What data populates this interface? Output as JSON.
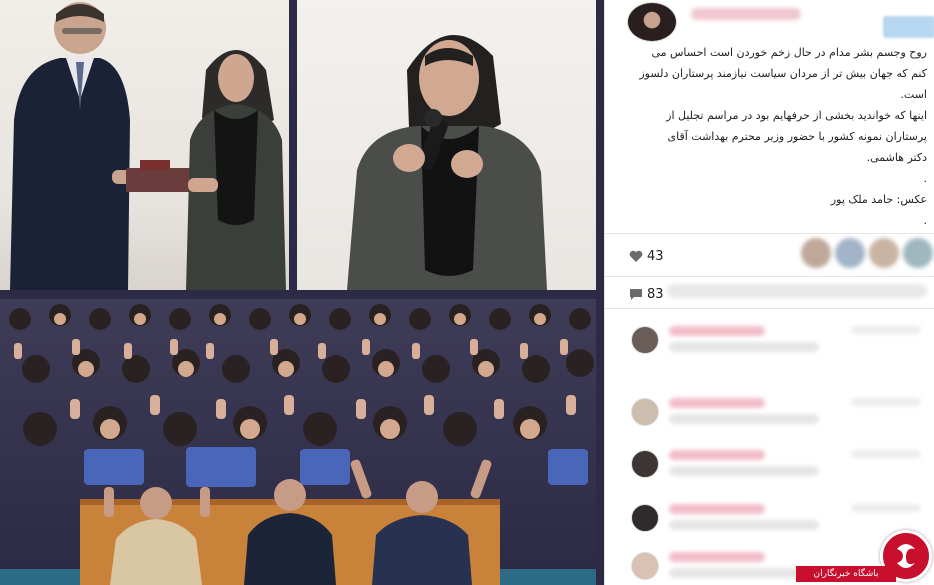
{
  "post": {
    "caption_lines": [
      "روح وجسم بشر مدام در حال زخم خوردن است احساس می",
      "کنم که جهان بیش تر از مردان سیاست نیازمند پرستاران دلسوز",
      "است.",
      "اینها که خواندید بخشی از حرفهایم بود در مراسم تجلیل از",
      "پرستاران نمونه کشور با حضور وزیر محترم بهداشت آقای",
      "دکتر هاشمی.",
      ".",
      "عکس: حامد ملک پور",
      "."
    ],
    "likes_count": "43",
    "comments_count": "83"
  },
  "watermark": {
    "label": "باشگاه خبرنگاران"
  },
  "icons": {
    "like": "heart-icon",
    "comment": "comment-icon",
    "watermark": "ybc-logo-icon"
  },
  "colors": {
    "accent": "#3897f0",
    "watermark": "#c8102e"
  }
}
